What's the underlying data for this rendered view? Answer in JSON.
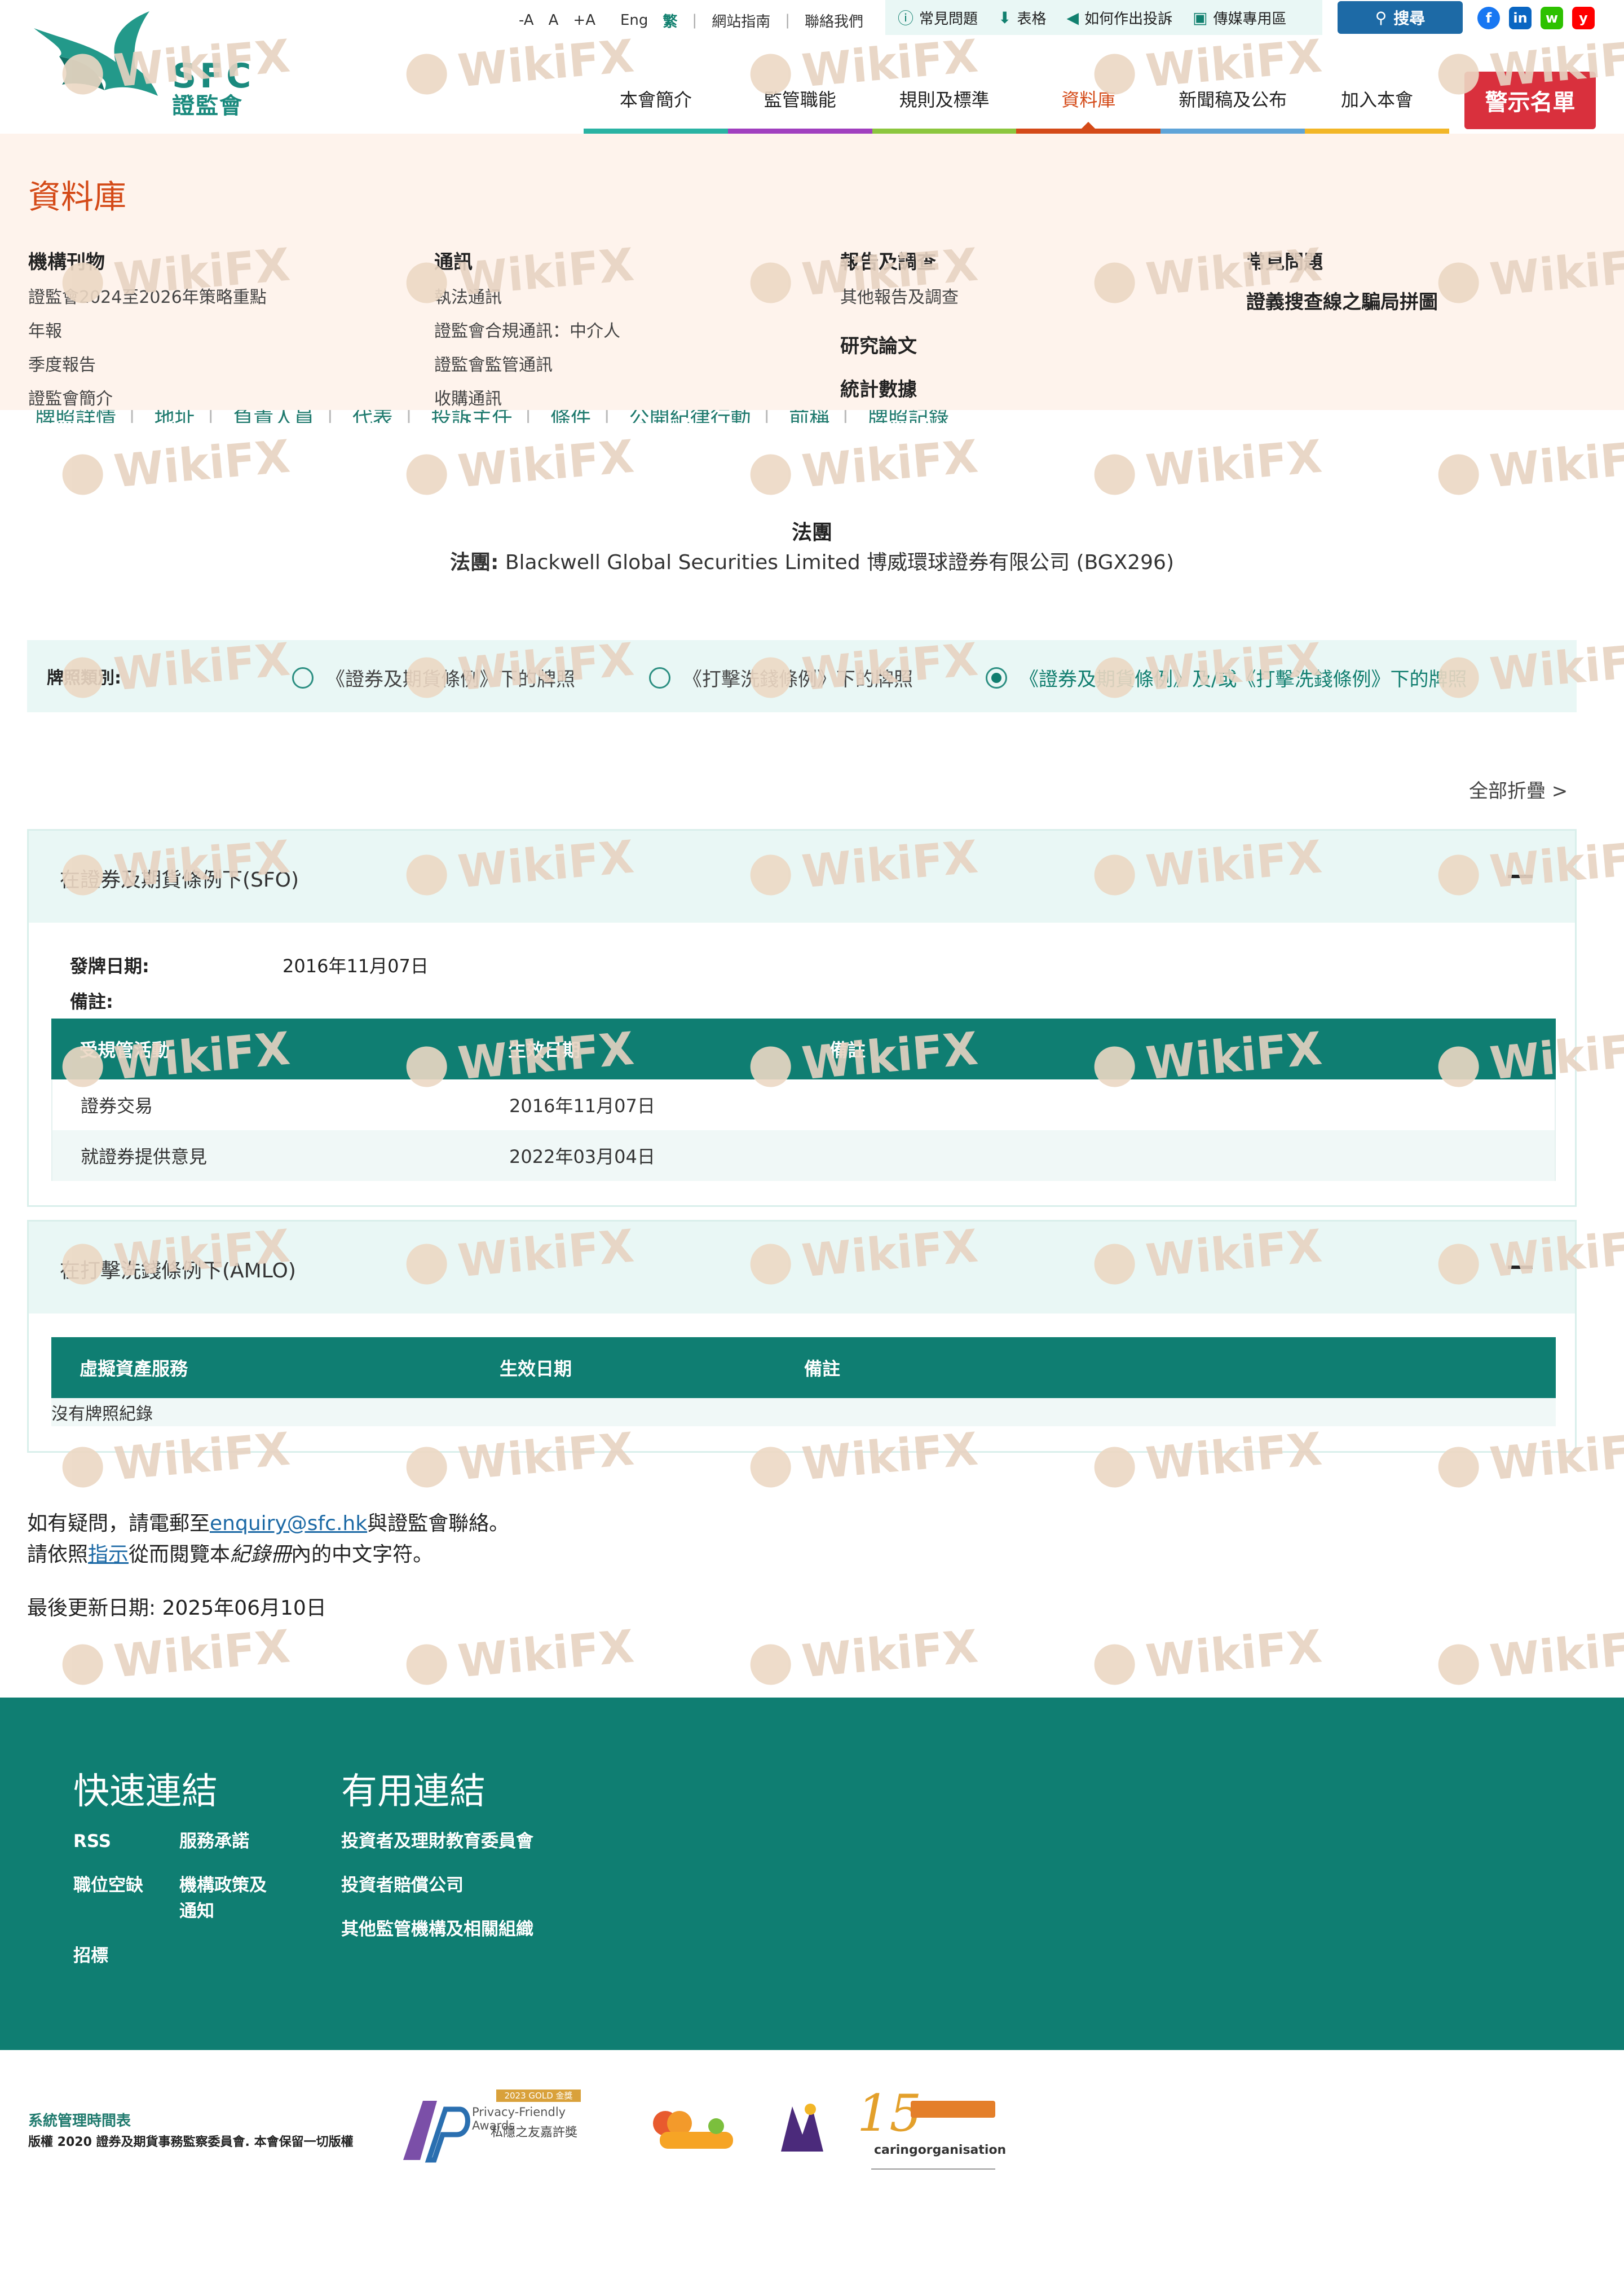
{
  "brand": {
    "abbr": "SFC",
    "zh": "證監會"
  },
  "util_links": {
    "smaller": "-A",
    "normal": "A",
    "larger": "+A",
    "eng": "Eng",
    "trad": "繁",
    "sitemap": "網站指南",
    "contact": "聯絡我們"
  },
  "util_box": {
    "faq": "常見問題",
    "forms": "表格",
    "complaint": "如何作出投訴",
    "media": "傳媒專用區"
  },
  "search_label": "搜尋",
  "social": [
    "f",
    "in",
    "w",
    "y"
  ],
  "nav": [
    {
      "label": "本會簡介",
      "color": "#2ab3a3"
    },
    {
      "label": "監管職能",
      "color": "#a13fbf"
    },
    {
      "label": "規則及標準",
      "color": "#8cc63e"
    },
    {
      "label": "資料庫",
      "color": "#d44a18",
      "active": true
    },
    {
      "label": "新聞稿及公布",
      "color": "#5fa4d8"
    },
    {
      "label": "加入本會",
      "color": "#f2b627"
    }
  ],
  "alert_button": "警示名單",
  "library": {
    "title": "資料庫",
    "col1": {
      "head": "機構刊物",
      "links": [
        "證監會2024至2026年策略重點",
        "年報",
        "季度報告",
        "證監會簡介"
      ]
    },
    "col2": {
      "head": "通訊",
      "links": [
        "執法通訊",
        "證監會合規通訊：中介人",
        "證監會監管通訊",
        "收購通訊"
      ]
    },
    "col3": {
      "head": "報告及調查",
      "links": [
        "其他報告及調查"
      ],
      "head2": "研究論文",
      "head3": "統計數據"
    },
    "col4": {
      "head": "常見問題",
      "link_bold": "證義搜查線之騙局拼圖"
    }
  },
  "subtabs": [
    "牌照詳情",
    "地址",
    "負責人員",
    "代表",
    "投訴主任",
    "條件",
    "公開紀律行動",
    "前稱",
    "牌照記錄"
  ],
  "entity": {
    "kind": "法團",
    "label": "法團:",
    "name": "Blackwell Global Securities Limited 博威環球證券有限公司 (BGX296)"
  },
  "license_type": {
    "label": "牌照類別:",
    "options": [
      "《證券及期貨條例》下的牌照",
      "《打擊洗錢條例》下的牌照",
      "《證券及期貨條例》及/或《打擊洗錢條例》下的牌照"
    ]
  },
  "collapse_all": "全部折疊 >",
  "sfo": {
    "title": "在證券及期貨條例下(SFO)",
    "issue_label": "發牌日期:",
    "issue_date": "2016年11月07日",
    "remark_label": "備註:",
    "columns": [
      "受規管活動",
      "生效日期",
      "備註"
    ],
    "rows": [
      {
        "activity": "證券交易",
        "date": "2016年11月07日"
      },
      {
        "activity": "就證券提供意見",
        "date": "2022年03月04日"
      }
    ]
  },
  "amlo": {
    "title": "在打擊洗錢條例下(AMLO)",
    "columns": [
      "虛擬資產服務",
      "生效日期",
      "備註"
    ],
    "empty": "沒有牌照紀錄"
  },
  "notes": {
    "l1a": "如有疑問，請電郵至",
    "email": "enquiry@sfc.hk",
    "l1b": "與證監會聯絡。",
    "l2a": "請依照",
    "guide": "指示",
    "l2b": "從而閱覽本",
    "record": "紀錄冊",
    "l2c": "內的中文字符。",
    "updated": "最後更新日期: 2025年06月10日"
  },
  "footer": {
    "quick": "快速連結",
    "useful": "有用連結",
    "quick_links": [
      "RSS",
      "服務承諾",
      "職位空缺",
      "機構政策及\n通知",
      "招標"
    ],
    "useful_links": [
      "投資者及理財教育委員會",
      "投資者賠償公司",
      "其他監管機構及相關組織"
    ],
    "sys": "系統管理時間表",
    "copyright": "版權 2020 證券及期貨事務監察委員會. 本會保留一切版權"
  },
  "badges": {
    "pcpd_line1": "2023 GOLD 金獎",
    "pcpd_line2": "Privacy-Friendly Awards",
    "pcpd_line3": "私隱之友嘉許獎",
    "caring": "caringorganisation",
    "caring_num": "15"
  },
  "watermark": "WikiFX"
}
